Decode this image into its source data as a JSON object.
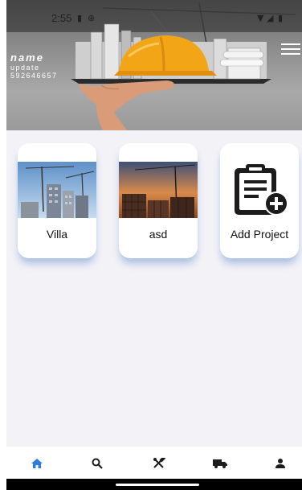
{
  "status": {
    "time": "2:55"
  },
  "header": {
    "name": "name",
    "subtitle": "update",
    "phone": "592646657"
  },
  "projects": [
    {
      "label": "Villa"
    },
    {
      "label": "asd"
    },
    {
      "label": "Add Project"
    }
  ],
  "bottom_nav": [
    {
      "icon": "home-icon",
      "active": true
    },
    {
      "icon": "search-icon",
      "active": false
    },
    {
      "icon": "tools-icon",
      "active": false
    },
    {
      "icon": "truck-icon",
      "active": false
    },
    {
      "icon": "person-icon",
      "active": false
    }
  ],
  "colors": {
    "accent": "#2f7de1",
    "icon_dark": "#1c1c1c",
    "shadow": "#4678c8"
  }
}
